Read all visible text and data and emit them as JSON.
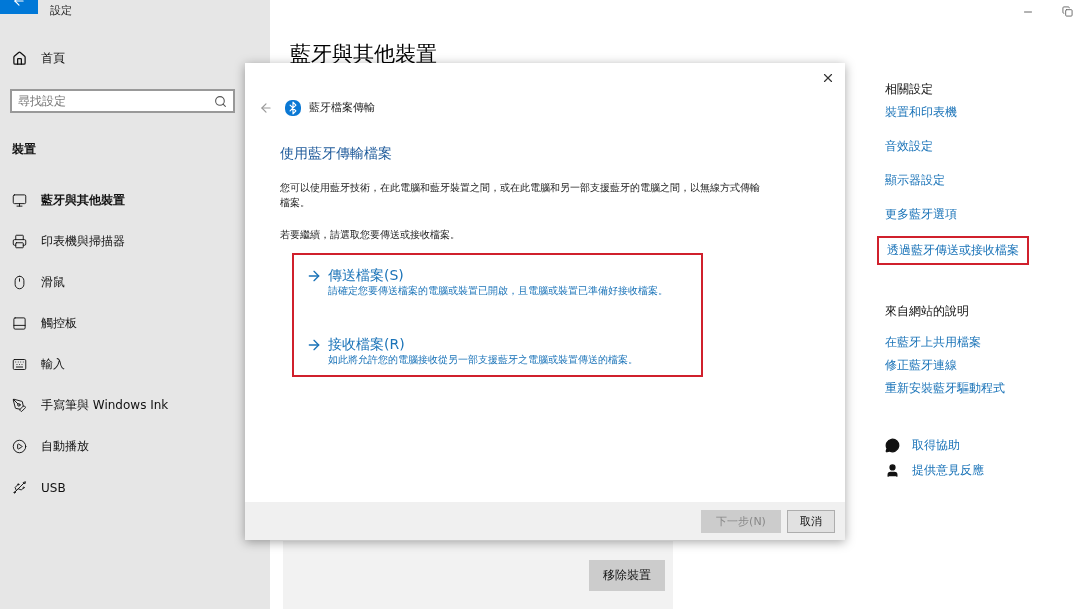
{
  "window": {
    "title": "設定"
  },
  "sidebar": {
    "home": "首頁",
    "search": {
      "placeholder": "尋找設定"
    },
    "section": "裝置",
    "items": [
      {
        "label": "藍牙與其他裝置",
        "selected": true
      },
      {
        "label": "印表機與掃描器",
        "selected": false
      },
      {
        "label": "滑鼠",
        "selected": false
      },
      {
        "label": "觸控板",
        "selected": false
      },
      {
        "label": "輸入",
        "selected": false
      },
      {
        "label": "手寫筆與 Windows Ink",
        "selected": false
      },
      {
        "label": "自動播放",
        "selected": false
      },
      {
        "label": "USB",
        "selected": false
      }
    ]
  },
  "page": {
    "title": "藍牙與其他裝置",
    "remove_button": "移除裝置"
  },
  "related": {
    "heading": "相關設定",
    "links": [
      {
        "label": "裝置和印表機",
        "highlighted": false
      },
      {
        "label": "音效設定",
        "highlighted": false
      },
      {
        "label": "顯示器設定",
        "highlighted": false
      },
      {
        "label": "更多藍牙選項",
        "highlighted": false
      },
      {
        "label": "透過藍牙傳送或接收檔案",
        "highlighted": true
      }
    ]
  },
  "web_help": {
    "heading": "來自網站的說明",
    "links": [
      "在藍牙上共用檔案",
      "修正藍牙連線",
      "重新安裝藍牙驅動程式"
    ]
  },
  "support": [
    "取得協助",
    "提供意見反應"
  ],
  "dialog": {
    "title": "藍牙檔案傳輸",
    "heading": "使用藍牙傳輸檔案",
    "description": "您可以使用藍牙技術，在此電腦和藍牙裝置之間，或在此電腦和另一部支援藍牙的電腦之間，以無線方式傳輸檔案。",
    "prompt": "若要繼續，請選取您要傳送或接收檔案。",
    "options_highlighted": true,
    "options": [
      {
        "title": "傳送檔案(S)",
        "description": "請確定您要傳送檔案的電腦或裝置已開啟，且電腦或裝置已準備好接收檔案。"
      },
      {
        "title": "接收檔案(R)",
        "description": "如此將允許您的電腦接收從另一部支援藍牙之電腦或裝置傳送的檔案。"
      }
    ],
    "buttons": [
      {
        "label": "下一步(N)",
        "disabled": true
      },
      {
        "label": "取消",
        "disabled": false
      }
    ]
  }
}
